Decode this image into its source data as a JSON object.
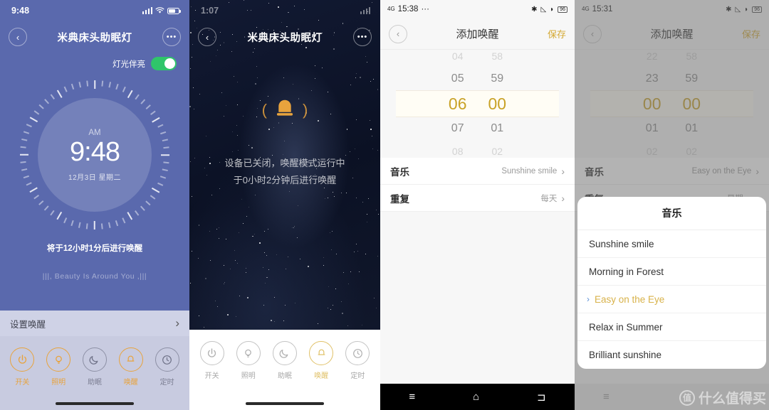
{
  "panel1": {
    "status": {
      "time": "9:48"
    },
    "nav": {
      "back": "‹",
      "title": "米典床头助眠灯",
      "more": "•••"
    },
    "toggle": {
      "label": "灯光伴亮",
      "state": "on",
      "color": "#2fc56a"
    },
    "clock": {
      "meridiem": "AM",
      "time": "9:48",
      "date": "12月3日  星期二"
    },
    "hint": "将于12小时1分后进行唤醒",
    "music_line": "Beauty Is Around You",
    "set_row": {
      "label": "设置唤醒",
      "chevron": "›"
    },
    "actions": [
      {
        "label": "开关",
        "icon": "power-icon",
        "active": true
      },
      {
        "label": "照明",
        "icon": "bulb-icon",
        "active": true
      },
      {
        "label": "助眠",
        "icon": "moon-icon",
        "active": false
      },
      {
        "label": "唤醒",
        "icon": "bell-icon",
        "active": true
      },
      {
        "label": "定时",
        "icon": "clock-icon",
        "active": false
      }
    ],
    "accent": "#e8a33d",
    "bg": "#5a69ad"
  },
  "panel2": {
    "status": {
      "time": "1:07"
    },
    "nav": {
      "back": "‹",
      "title": "米典床头助眠灯",
      "more": "•••"
    },
    "bell": {
      "icon": "bell-icon",
      "color": "#e8a33d"
    },
    "message_line1": "设备已关闭，唤醒模式运行中",
    "message_line2": "于0小时2分钟后进行唤醒",
    "actions": [
      {
        "label": "开关",
        "icon": "power-icon",
        "active": false
      },
      {
        "label": "照明",
        "icon": "bulb-icon",
        "active": false
      },
      {
        "label": "助眠",
        "icon": "moon-icon",
        "active": false
      },
      {
        "label": "唤醒",
        "icon": "bell-icon",
        "active": true
      },
      {
        "label": "定时",
        "icon": "clock-icon",
        "active": false
      }
    ]
  },
  "panel3": {
    "status": {
      "network": "4G",
      "time": "15:38",
      "dots": "···",
      "battery": "96"
    },
    "nav": {
      "back": "‹",
      "title": "添加唤醒",
      "save": "保存"
    },
    "picker": {
      "hours": [
        "04",
        "05",
        "06",
        "07",
        "08"
      ],
      "minutes": [
        "58",
        "59",
        "00",
        "01",
        "02"
      ],
      "selected_hour": "06",
      "selected_minute": "00"
    },
    "rows": [
      {
        "key": "音乐",
        "value": "Sunshine smile",
        "chevron": "›"
      },
      {
        "key": "重复",
        "value": "每天",
        "chevron": "›"
      }
    ],
    "navbar": {
      "menu": "≡",
      "home": "⌂",
      "back": "⊐"
    }
  },
  "panel4": {
    "status": {
      "network": "4G",
      "time": "15:31",
      "battery": "96"
    },
    "nav": {
      "back": "‹",
      "title": "添加唤醒",
      "save": "保存"
    },
    "picker": {
      "hours": [
        "22",
        "23",
        "00",
        "01",
        "02"
      ],
      "minutes": [
        "58",
        "59",
        "00",
        "01",
        "02"
      ],
      "selected_hour": "00",
      "selected_minute": "00"
    },
    "rows": [
      {
        "key": "音乐",
        "value": "Easy on the Eye",
        "chevron": "›"
      },
      {
        "key": "重复",
        "value": "星期一",
        "chevron": "›"
      }
    ],
    "sheet": {
      "title": "音乐",
      "items": [
        {
          "label": "Sunshine smile",
          "selected": false
        },
        {
          "label": "Morning in Forest",
          "selected": false
        },
        {
          "label": "Easy on the Eye",
          "selected": true
        },
        {
          "label": "Relax in Summer",
          "selected": false
        },
        {
          "label": "Brilliant sunshine",
          "selected": false
        }
      ],
      "selected_color": "#d8b24a",
      "arrow": "›"
    },
    "navbar": {
      "menu": "≡"
    },
    "watermark": {
      "badge": "值",
      "text": "什么值得买"
    }
  }
}
